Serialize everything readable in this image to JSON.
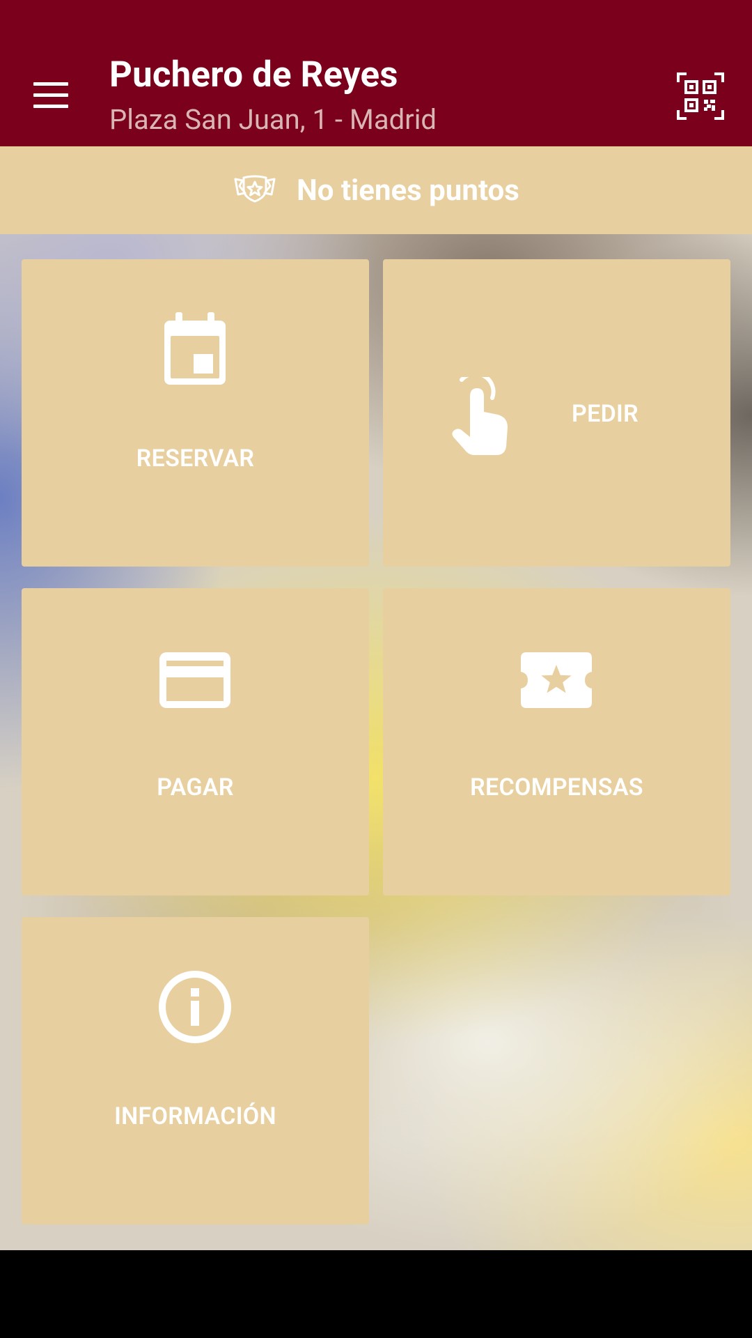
{
  "header": {
    "title": "Puchero de Reyes",
    "subtitle": "Plaza San Juan, 1 - Madrid",
    "menu_icon": "menu-icon",
    "qr_icon": "qr-code-icon"
  },
  "points": {
    "icon": "badge-star-icon",
    "text": "No tienes puntos"
  },
  "tiles": [
    {
      "label": "RESERVAR",
      "icon": "calendar-icon"
    },
    {
      "label": "PEDIR",
      "icon": "touch-hand-icon"
    },
    {
      "label": "PAGAR",
      "icon": "credit-card-icon"
    },
    {
      "label": "RECOMPENSAS",
      "icon": "ticket-star-icon"
    },
    {
      "label": "INFORMACIÓN",
      "icon": "info-icon"
    }
  ],
  "colors": {
    "app_bar": "#7a001c",
    "accent_tile": "#e8cf9f",
    "subtitle": "#d9b6b3"
  }
}
